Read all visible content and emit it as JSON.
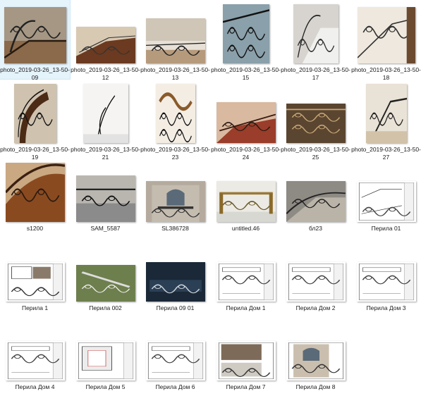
{
  "window": {
    "view": "explorer-large-icons"
  },
  "files": [
    {
      "name": "photo_2019-03-26_13-50-09",
      "kind": "photo",
      "scene": "stair-dark"
    },
    {
      "name": "photo_2019-03-26_13-50-12",
      "kind": "photo",
      "scene": "stair-wood"
    },
    {
      "name": "photo_2019-03-26_13-50-13",
      "kind": "photo",
      "scene": "balcony"
    },
    {
      "name": "photo_2019-03-26_13-50-15",
      "kind": "photo",
      "scene": "rail-blue"
    },
    {
      "name": "photo_2019-03-26_13-50-17",
      "kind": "photo",
      "scene": "stair-white"
    },
    {
      "name": "photo_2019-03-26_13-50-18",
      "kind": "photo",
      "scene": "stair-wood-light"
    },
    {
      "name": "photo_2019-03-26_13-50-19",
      "kind": "photo",
      "scene": "spiral-dark"
    },
    {
      "name": "photo_2019-03-26_13-50-21",
      "kind": "photo",
      "scene": "white-hall"
    },
    {
      "name": "photo_2019-03-26_13-50-23",
      "kind": "photo",
      "scene": "scroll-rail"
    },
    {
      "name": "photo_2019-03-26_13-50-24",
      "kind": "photo",
      "scene": "red-stair"
    },
    {
      "name": "photo_2019-03-26_13-50-25",
      "kind": "photo",
      "scene": "brown-scroll"
    },
    {
      "name": "photo_2019-03-26_13-50-27",
      "kind": "photo",
      "scene": "stair-beige"
    },
    {
      "name": "s1200",
      "kind": "photo",
      "scene": "wood-curve"
    },
    {
      "name": "SAM_5587",
      "kind": "photo",
      "scene": "fence-grey"
    },
    {
      "name": "SL386728",
      "kind": "photo",
      "scene": "facade"
    },
    {
      "name": "untitled.46",
      "kind": "render",
      "scene": "render-rail"
    },
    {
      "name": "бл23",
      "kind": "photo",
      "scene": "stone-stair"
    },
    {
      "name": "Перила 01",
      "kind": "drawing",
      "scene": "drawing-stair"
    },
    {
      "name": "Перила 1",
      "kind": "drawing",
      "scene": "drawing-mixed"
    },
    {
      "name": "Перила 002",
      "kind": "render",
      "scene": "render-green"
    },
    {
      "name": "Перила 09  01",
      "kind": "drawing",
      "scene": "drawing-dark"
    },
    {
      "name": "Перила Дом 1",
      "kind": "drawing",
      "scene": "drawing-sheet"
    },
    {
      "name": "Перила Дом 2",
      "kind": "drawing",
      "scene": "drawing-sheet"
    },
    {
      "name": "Перила Дом 3",
      "kind": "drawing",
      "scene": "drawing-sheet"
    },
    {
      "name": "Перила Дом 4",
      "kind": "drawing",
      "scene": "drawing-sheet"
    },
    {
      "name": "Перила Дом 5",
      "kind": "drawing",
      "scene": "drawing-box"
    },
    {
      "name": "Перила Дом 6",
      "kind": "drawing",
      "scene": "drawing-sheet"
    },
    {
      "name": "Перила Дом 7",
      "kind": "drawing",
      "scene": "photo-sheet"
    },
    {
      "name": "Перила Дом 8",
      "kind": "drawing",
      "scene": "balcony-sheet"
    }
  ]
}
